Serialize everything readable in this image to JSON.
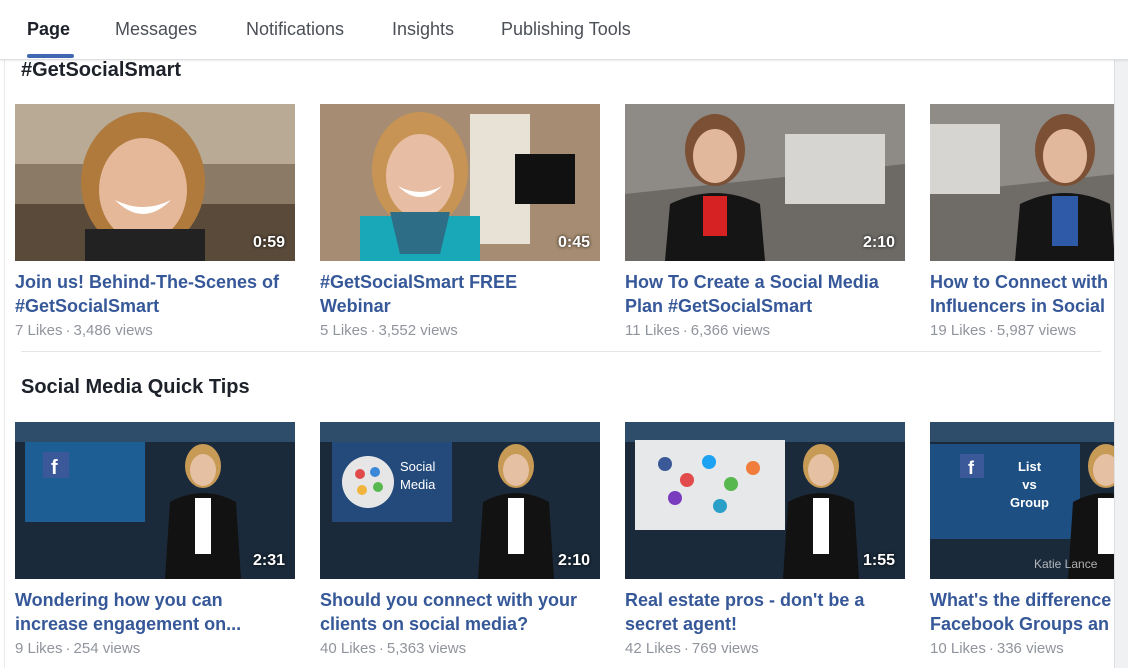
{
  "nav": {
    "tabs": [
      "Page",
      "Messages",
      "Notifications",
      "Insights",
      "Publishing Tools"
    ]
  },
  "sections": [
    {
      "title": "#GetSocialSmart",
      "videos": [
        {
          "title": "Join us! Behind-The-Scenes of\n#GetSocialSmart",
          "likes": "7 Likes",
          "views": "3,486 views",
          "duration": "0:59"
        },
        {
          "title": "#GetSocialSmart FREE\nWebinar",
          "likes": "5 Likes",
          "views": "3,552 views",
          "duration": "0:45"
        },
        {
          "title": "How To Create a Social Media\nPlan #GetSocialSmart",
          "likes": "11 Likes",
          "views": "6,366 views",
          "duration": "2:10"
        },
        {
          "title": "How to Connect with\nInfluencers in Social",
          "likes": "19 Likes",
          "views": "5,987 views",
          "duration": ""
        }
      ]
    },
    {
      "title": "Social Media Quick Tips",
      "videos": [
        {
          "title": "Wondering how you can\nincrease engagement on...",
          "likes": "9 Likes",
          "views": "254 views",
          "duration": "2:31"
        },
        {
          "title": "Should you connect with your\nclients on social media?",
          "likes": "40 Likes",
          "views": "5,363 views",
          "duration": "2:10",
          "overlay": "Social\nMedia"
        },
        {
          "title": "Real estate pros - don't be a\nsecret agent!",
          "likes": "42 Likes",
          "views": "769 views",
          "duration": "1:55"
        },
        {
          "title": "What's the difference\nFacebook Groups an",
          "likes": "10 Likes",
          "views": "336 views",
          "duration": "",
          "overlay": "List\nvs\nGroup",
          "watermark": "Katie Lance"
        }
      ]
    }
  ],
  "meta_separator": "·",
  "colors": {
    "link": "#365899",
    "accent": "#4267b2",
    "muted": "#90949c"
  }
}
